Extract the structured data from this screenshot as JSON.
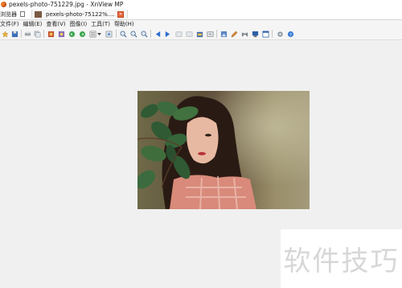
{
  "window": {
    "title": "pexels-photo-751229.jpg - XnView MP"
  },
  "tabs": {
    "browser_label": "浏览器",
    "image_tab_label": "pexels-photo-75122%...."
  },
  "menu": {
    "items": [
      "文件(F)",
      "编辑(E)",
      "查看(V)",
      "图像(I)",
      "工具(T)",
      "帮助(H)"
    ]
  },
  "toolbar": {
    "icons": [
      "favorite-icon",
      "save-icon",
      "print-icon",
      "copy-icon",
      "image-settings-icon",
      "slideshow-icon",
      "rotate-left-icon",
      "rotate-right-icon",
      "view-mode-icon",
      "export-icon",
      "zoom-in-icon",
      "zoom-out-icon",
      "zoom-fit-icon",
      "previous-icon",
      "next-icon",
      "first-icon",
      "last-icon",
      "folder-icon",
      "fullscreen-icon",
      "crop-icon",
      "edit-icon",
      "printer-icon",
      "monitor-icon",
      "window-icon",
      "settings-icon",
      "help-icon"
    ]
  },
  "watermark": {
    "text": "软件技巧"
  },
  "colors": {
    "app_icon": "#e87722",
    "canvas_background": "#f0f0f0",
    "accent_blue": "#2e6fcf"
  }
}
